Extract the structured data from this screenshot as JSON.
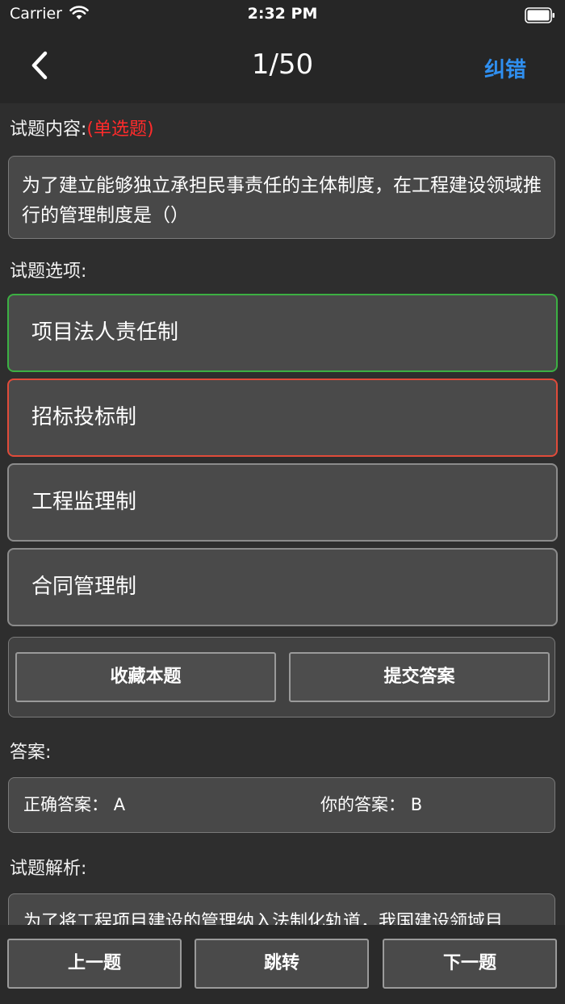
{
  "status": {
    "carrier": "Carrier",
    "time": "2:32 PM"
  },
  "nav": {
    "title": "1/50",
    "report_label": "纠错"
  },
  "question": {
    "content_label": "试题内容:",
    "type": "(单选题)",
    "text": "为了建立能够独立承担民事责任的主体制度，在工程建设领域推行的管理制度是（）"
  },
  "options": {
    "label": "试题选项:",
    "items": [
      {
        "text": "项目法人责任制",
        "state": "correct"
      },
      {
        "text": "招标投标制",
        "state": "wrong"
      },
      {
        "text": "工程监理制",
        "state": "normal"
      },
      {
        "text": "合同管理制",
        "state": "normal"
      }
    ]
  },
  "actions": {
    "favorite_label": "收藏本题",
    "submit_label": "提交答案"
  },
  "answer": {
    "label": "答案:",
    "correct_label": "正确答案：",
    "correct_value": "A",
    "yours_label": "你的答案：",
    "yours_value": "B"
  },
  "analysis": {
    "label": "试题解析:",
    "text": "为了将工程项目建设的管理纳入法制化轨道，我国建设领域目"
  },
  "bottom": {
    "prev_label": "上一题",
    "jump_label": "跳转",
    "next_label": "下一题"
  },
  "colors": {
    "correct": "#3cb043",
    "wrong": "#e04b3a",
    "accent": "#2f8ff0",
    "qtype": "#ff2b2b"
  }
}
